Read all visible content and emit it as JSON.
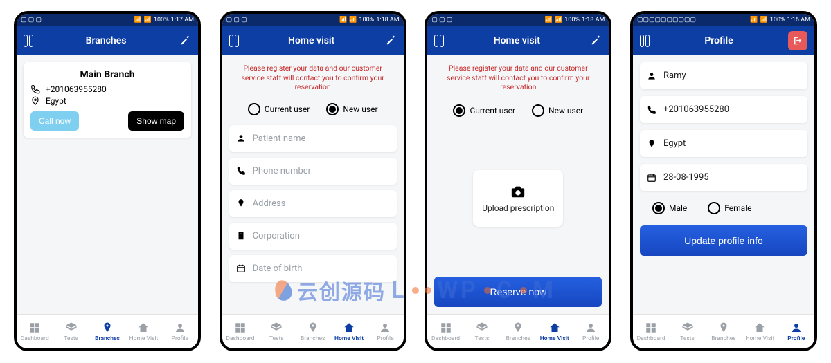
{
  "status": {
    "battery": "100%",
    "t1": "1:17 AM",
    "t2": "1:18 AM",
    "t3": "1:18 AM",
    "t4": "1:16 AM"
  },
  "screen1": {
    "title": "Branches",
    "branch_title": "Main Branch",
    "phone": "+201063955280",
    "country": "Egypt",
    "call_btn": "Call now",
    "map_btn": "Show map"
  },
  "screen2": {
    "title": "Home visit",
    "instruction": "Please register your data  and our customer service staff will contact  you to confirm your reservation",
    "radio_current": "Current user",
    "radio_new": "New user",
    "fields": {
      "name": "Patient name",
      "phone": "Phone number",
      "address": "Address",
      "corp": "Corporation",
      "dob": "Date of birth"
    }
  },
  "screen3": {
    "title": "Home visit",
    "instruction": "Please register your data  and our customer service staff will contact  you to confirm your reservation",
    "radio_current": "Current user",
    "radio_new": "New user",
    "upload_label": "Upload prescription",
    "reserve_btn": "Reserve now"
  },
  "screen4": {
    "title": "Profile",
    "name": "Ramy",
    "phone": "+201063955280",
    "country": "Egypt",
    "dob": "28-08-1995",
    "male": "Male",
    "female": "Female",
    "update_btn": "Update profile info"
  },
  "nav": {
    "dashboard": "Dashboard",
    "tests": "Tests",
    "branches": "Branches",
    "home_visit": "Home Visit",
    "profile": "Profile"
  },
  "watermark": {
    "cn": "云创源码",
    "en": "LOOWP COM"
  }
}
